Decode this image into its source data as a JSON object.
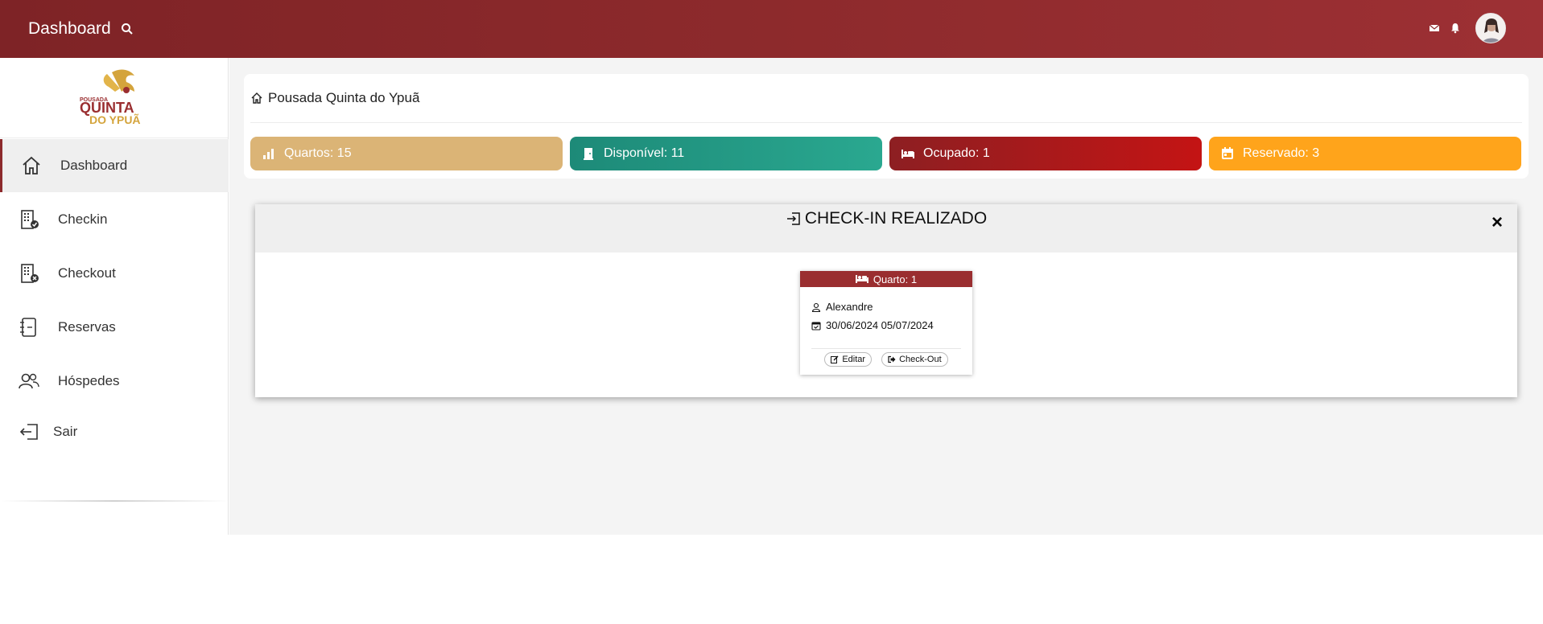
{
  "header": {
    "title": "Dashboard",
    "icons": [
      "search-icon",
      "envelope-icon",
      "bell-icon",
      "avatar"
    ]
  },
  "sidebar": {
    "logo": {
      "line1": "POUSADA",
      "line2": "QUINTA",
      "line3": "DO YPUÃ"
    },
    "items": [
      {
        "label": "Dashboard",
        "icon": "home-icon",
        "active": true
      },
      {
        "label": "Checkin",
        "icon": "building-check-icon"
      },
      {
        "label": "Checkout",
        "icon": "building-x-icon"
      },
      {
        "label": "Reservas",
        "icon": "notebook-icon"
      },
      {
        "label": "Hóspedes",
        "icon": "people-icon"
      },
      {
        "label": "Sair",
        "icon": "logout-icon"
      }
    ]
  },
  "breadcrumb": {
    "label": "Pousada Quinta do Ypuã",
    "icon": "home-icon"
  },
  "stats": [
    {
      "label": "Quartos: 15",
      "icon": "bar-chart-icon",
      "color": "#dbb476"
    },
    {
      "label": "Disponível: 11",
      "icon": "door-icon",
      "color": "#1d8a78"
    },
    {
      "label": "Ocupado: 1",
      "icon": "bed-icon",
      "color": "#a41b1f"
    },
    {
      "label": "Reservado: 3",
      "icon": "calendar-icon",
      "color": "#ffa41b"
    }
  ],
  "modal": {
    "title": "CHECK-IN REALIZADO",
    "close": "×",
    "room": {
      "title": "Quarto: 1",
      "guest": "Alexandre",
      "dates": "30/06/2024 05/07/2024",
      "edit_label": "Editar",
      "checkout_label": "Check-Out"
    }
  },
  "colors": {
    "header": "#8d2a2c",
    "accent": "#9a2e30",
    "background": "#f4f4f4"
  }
}
